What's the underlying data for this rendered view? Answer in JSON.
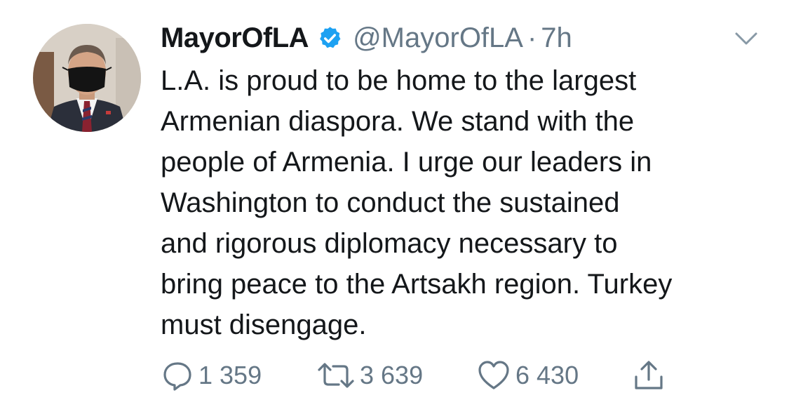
{
  "tweet": {
    "display_name": "MayorOfLA",
    "handle": "@MayorOfLA",
    "separator": "·",
    "time": "7h",
    "text_lines": [
      "L.A. is proud to be home to the largest",
      "Armenian diaspora. We stand with the",
      "people of Armenia. I urge our leaders in",
      "Washington to conduct the sustained",
      "and rigorous diplomacy necessary to",
      "bring peace to the Artsakh region. Turkey",
      "must disengage."
    ],
    "actions": {
      "reply_count": "1 359",
      "retweet_count": "3 639",
      "like_count": "6 430"
    }
  },
  "icons": {
    "verified": "verified-badge-icon",
    "caret": "chevron-down-icon",
    "reply": "comment-icon",
    "retweet": "retweet-icon",
    "like": "heart-icon",
    "share": "share-icon"
  },
  "colors": {
    "text": "#14171a",
    "secondary": "#657786",
    "verified": "#1da1f2"
  }
}
